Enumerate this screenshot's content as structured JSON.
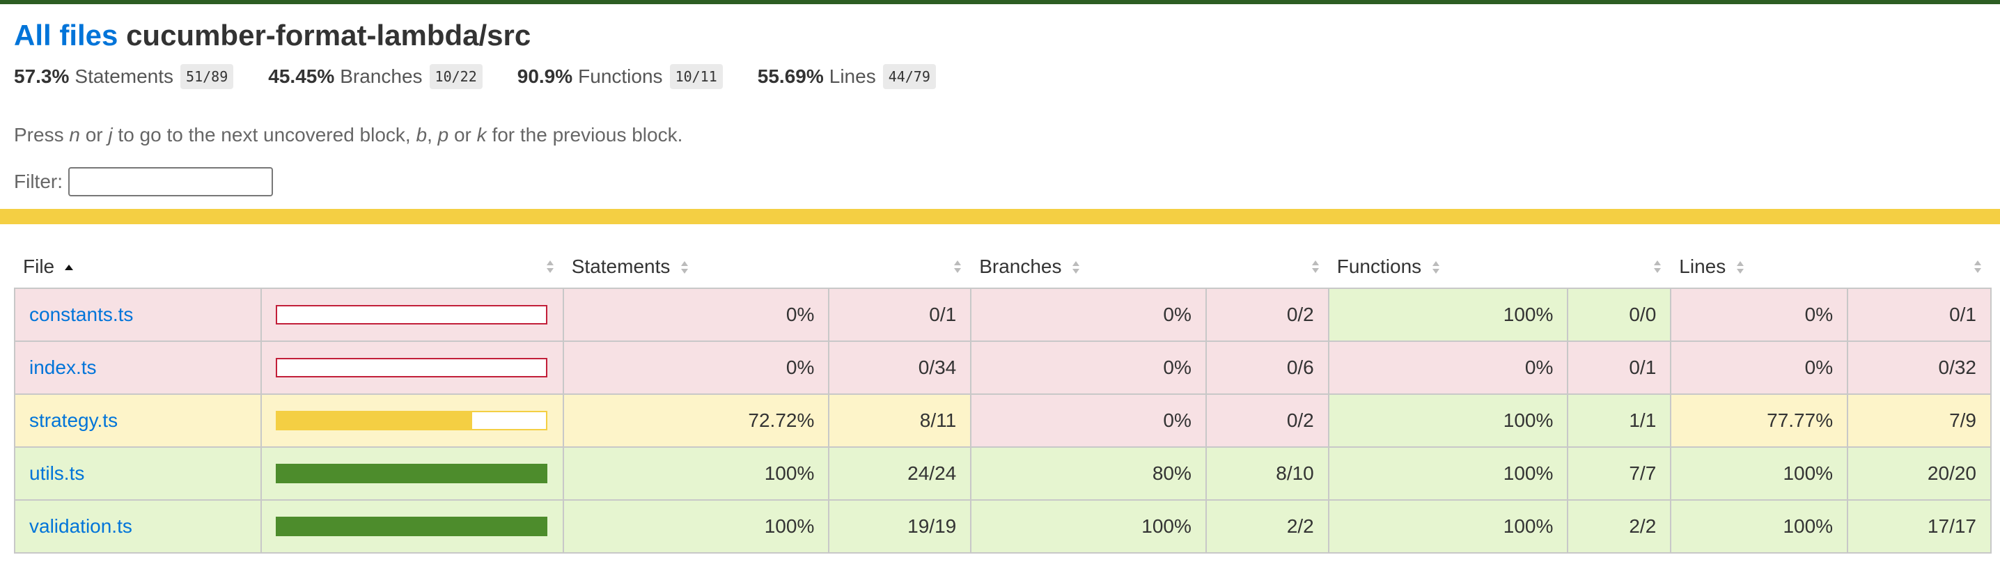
{
  "header": {
    "all_files_link": "All files",
    "path": "cucumber-format-lambda/src"
  },
  "summary": [
    {
      "pct": "57.3%",
      "label": "Statements",
      "fraction": "51/89"
    },
    {
      "pct": "45.45%",
      "label": "Branches",
      "fraction": "10/22"
    },
    {
      "pct": "90.9%",
      "label": "Functions",
      "fraction": "10/11"
    },
    {
      "pct": "55.69%",
      "label": "Lines",
      "fraction": "44/79"
    }
  ],
  "hint": {
    "t1": "Press ",
    "k1": "n",
    "t2": " or ",
    "k2": "j",
    "t3": " to go to the next uncovered block, ",
    "k3": "b",
    "t4": ", ",
    "k4": "p",
    "t5": " or ",
    "k5": "k",
    "t6": " for the previous block."
  },
  "filter": {
    "label": "Filter:",
    "value": ""
  },
  "colors": {
    "high": "#4d8c2c",
    "medium": "#f4cf43",
    "low": "#c21f39",
    "link": "#0074d9"
  },
  "table": {
    "headers": {
      "file": "File",
      "statements": "Statements",
      "branches": "Branches",
      "functions": "Functions",
      "lines": "Lines"
    },
    "rows": [
      {
        "file": "constants.ts",
        "level": "low",
        "coverage": 0,
        "statements_pct": "0%",
        "statements_frac": "0/1",
        "statements_level": "low",
        "branches_pct": "0%",
        "branches_frac": "0/2",
        "branches_level": "low",
        "functions_pct": "100%",
        "functions_frac": "0/0",
        "functions_level": "high",
        "lines_pct": "0%",
        "lines_frac": "0/1",
        "lines_level": "low"
      },
      {
        "file": "index.ts",
        "level": "low",
        "coverage": 0,
        "statements_pct": "0%",
        "statements_frac": "0/34",
        "statements_level": "low",
        "branches_pct": "0%",
        "branches_frac": "0/6",
        "branches_level": "low",
        "functions_pct": "0%",
        "functions_frac": "0/1",
        "functions_level": "low",
        "lines_pct": "0%",
        "lines_frac": "0/32",
        "lines_level": "low"
      },
      {
        "file": "strategy.ts",
        "level": "med",
        "coverage": 72.72,
        "statements_pct": "72.72%",
        "statements_frac": "8/11",
        "statements_level": "med",
        "branches_pct": "0%",
        "branches_frac": "0/2",
        "branches_level": "low",
        "functions_pct": "100%",
        "functions_frac": "1/1",
        "functions_level": "high",
        "lines_pct": "77.77%",
        "lines_frac": "7/9",
        "lines_level": "med"
      },
      {
        "file": "utils.ts",
        "level": "high",
        "coverage": 100,
        "statements_pct": "100%",
        "statements_frac": "24/24",
        "statements_level": "high",
        "branches_pct": "80%",
        "branches_frac": "8/10",
        "branches_level": "high",
        "functions_pct": "100%",
        "functions_frac": "7/7",
        "functions_level": "high",
        "lines_pct": "100%",
        "lines_frac": "20/20",
        "lines_level": "high"
      },
      {
        "file": "validation.ts",
        "level": "high",
        "coverage": 100,
        "statements_pct": "100%",
        "statements_frac": "19/19",
        "statements_level": "high",
        "branches_pct": "100%",
        "branches_frac": "2/2",
        "branches_level": "high",
        "functions_pct": "100%",
        "functions_frac": "2/2",
        "functions_level": "high",
        "lines_pct": "100%",
        "lines_frac": "17/17",
        "lines_level": "high"
      }
    ]
  }
}
